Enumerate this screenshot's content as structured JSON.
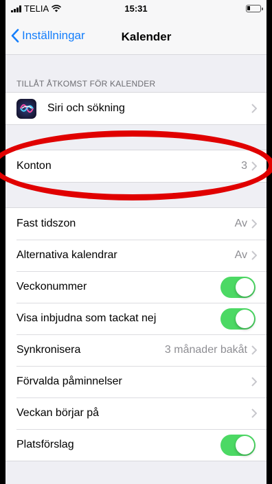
{
  "status_bar": {
    "carrier": "TELIA",
    "time": "15:31",
    "icons": [
      "signal-icon",
      "wifi-icon",
      "battery-icon"
    ]
  },
  "nav": {
    "back_label": "Inställningar",
    "title": "Kalender"
  },
  "sections": {
    "access_header": "TILLÅT ÅTKOMST FÖR KALENDER",
    "siri_label": "Siri och sökning",
    "konton_label": "Konton",
    "konton_value": "3"
  },
  "settings": {
    "fast_tidszon": {
      "label": "Fast tidszon",
      "value": "Av"
    },
    "alternativa": {
      "label": "Alternativa kalendrar",
      "value": "Av"
    },
    "veckonummer": {
      "label": "Veckonummer",
      "on": true
    },
    "visa_inbjudna": {
      "label": "Visa inbjudna som tackat nej",
      "on": true
    },
    "synkronisera": {
      "label": "Synkronisera",
      "value": "3 månader bakåt"
    },
    "forvalda": {
      "label": "Förvalda påminnelser"
    },
    "veckan": {
      "label": "Veckan börjar på"
    },
    "platsforslag": {
      "label": "Platsförslag",
      "on": true
    }
  },
  "colors": {
    "accent": "#147efb",
    "toggle_on": "#4cd964",
    "annotation": "#e00000"
  }
}
